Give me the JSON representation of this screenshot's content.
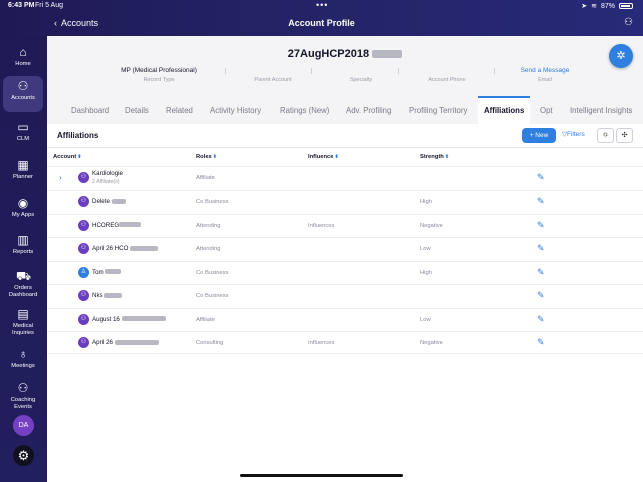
{
  "status": {
    "time": "6:43 PM",
    "date": "Fri 5 Aug",
    "battery": "87%"
  },
  "header": {
    "back_label": "Accounts",
    "title": "Account Profile",
    "more": "•••"
  },
  "sidebar": {
    "items": [
      {
        "label": "Home",
        "icon": "home-icon",
        "glyph": "⌂"
      },
      {
        "label": "Accounts",
        "icon": "accounts-icon",
        "glyph": "⚇",
        "active": true
      },
      {
        "label": "CLM",
        "icon": "clm-icon",
        "glyph": "▭"
      },
      {
        "label": "Planner",
        "icon": "calendar-icon",
        "glyph": "▦"
      },
      {
        "label": "My Apps",
        "icon": "apps-icon",
        "glyph": "◉"
      },
      {
        "label": "Reports",
        "icon": "reports-icon",
        "glyph": "▥"
      },
      {
        "label": "Orders Dashboard",
        "icon": "orders-icon",
        "glyph": "⛟"
      },
      {
        "label": "Medical Inquiries",
        "icon": "inquiries-icon",
        "glyph": "▤"
      },
      {
        "label": "Meetings",
        "icon": "microphone-icon",
        "glyph": "♁"
      },
      {
        "label": "Coaching Events",
        "icon": "coaching-icon",
        "glyph": "⚇"
      }
    ],
    "avatar_initials": "DA"
  },
  "profile": {
    "name": "27AugHCP2018",
    "record_type_value": "MP (Medical Professional)",
    "record_type_label": "Record Type",
    "parent_account_label": "Parent Account",
    "specialty_label": "Specialty",
    "account_phone_label": "Account Phone",
    "email_link": "Send a Message",
    "email_label": "Email"
  },
  "tabs": [
    "Dashboard",
    "Details",
    "Related",
    "Activity History",
    "Ratings (New)",
    "Adv. Profiling",
    "Profiling Territory",
    "Affiliations",
    "Opt",
    "Intelligent Insights"
  ],
  "active_tab": "Affiliations",
  "affiliations": {
    "title": "Affiliations",
    "new_button": "+ New",
    "filters_button": "Filters",
    "columns": {
      "account": "Account",
      "roles": "Roles",
      "influence": "Influence",
      "strength": "Strength"
    },
    "rows": [
      {
        "account": "Kardiologie",
        "sub": "2 Affiliate(s)",
        "role": "Affiliate",
        "influence": "",
        "strength": ""
      },
      {
        "account": "Delete",
        "sub": "",
        "role": "Co Business",
        "influence": "",
        "strength": "High"
      },
      {
        "account": "HCOREG",
        "sub": "",
        "role": "Attending",
        "influence": "Influences",
        "strength": "Negative"
      },
      {
        "account": "April 26 HCO",
        "sub": "",
        "role": "Attending",
        "influence": "",
        "strength": "Low"
      },
      {
        "account": "Tom",
        "sub": "",
        "role": "Co Business",
        "influence": "",
        "strength": "High"
      },
      {
        "account": "Nks",
        "sub": "",
        "role": "Co Business",
        "influence": "",
        "strength": ""
      },
      {
        "account": "August 16",
        "sub": "",
        "role": "Affiliate",
        "influence": "",
        "strength": "Low"
      },
      {
        "account": "April 26",
        "sub": "",
        "role": "Consulting",
        "influence": "Influences",
        "strength": "Negative"
      }
    ]
  },
  "colors": {
    "sidebar": "#1f1a55",
    "accent": "#2f7fe0",
    "account_icon": "#6a3dc0"
  }
}
